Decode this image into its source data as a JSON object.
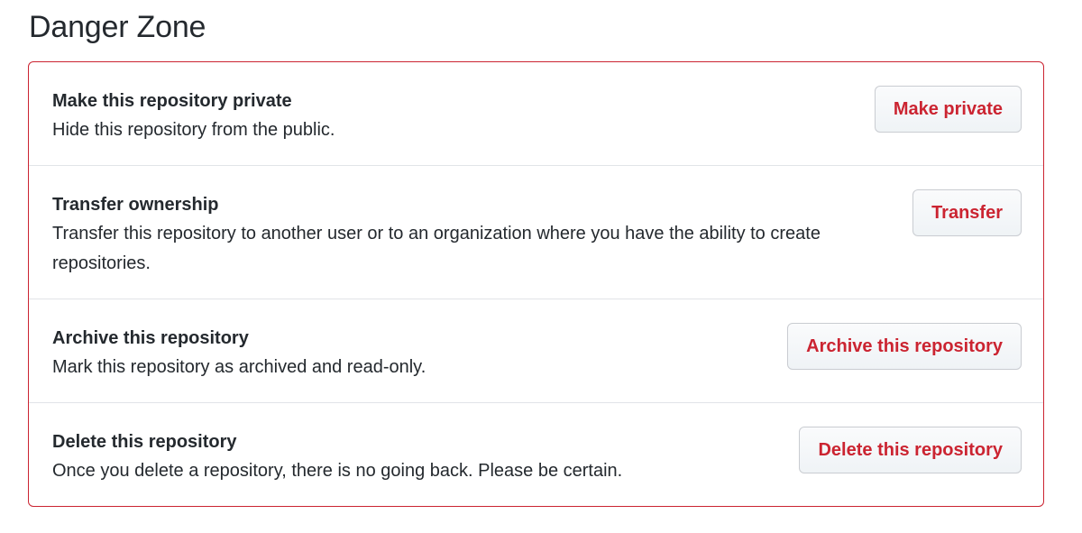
{
  "page": {
    "title": "Danger Zone"
  },
  "colors": {
    "danger": "#cb2431",
    "text": "#24292e",
    "divider": "#e1e4e8"
  },
  "rows": [
    {
      "title": "Make this repository private",
      "description": "Hide this repository from the public.",
      "button": "Make private"
    },
    {
      "title": "Transfer ownership",
      "description": "Transfer this repository to another user or to an organization where you have the ability to create repositories.",
      "button": "Transfer"
    },
    {
      "title": "Archive this repository",
      "description": "Mark this repository as archived and read-only.",
      "button": "Archive this repository"
    },
    {
      "title": "Delete this repository",
      "description": "Once you delete a repository, there is no going back. Please be certain.",
      "button": "Delete this repository"
    }
  ]
}
